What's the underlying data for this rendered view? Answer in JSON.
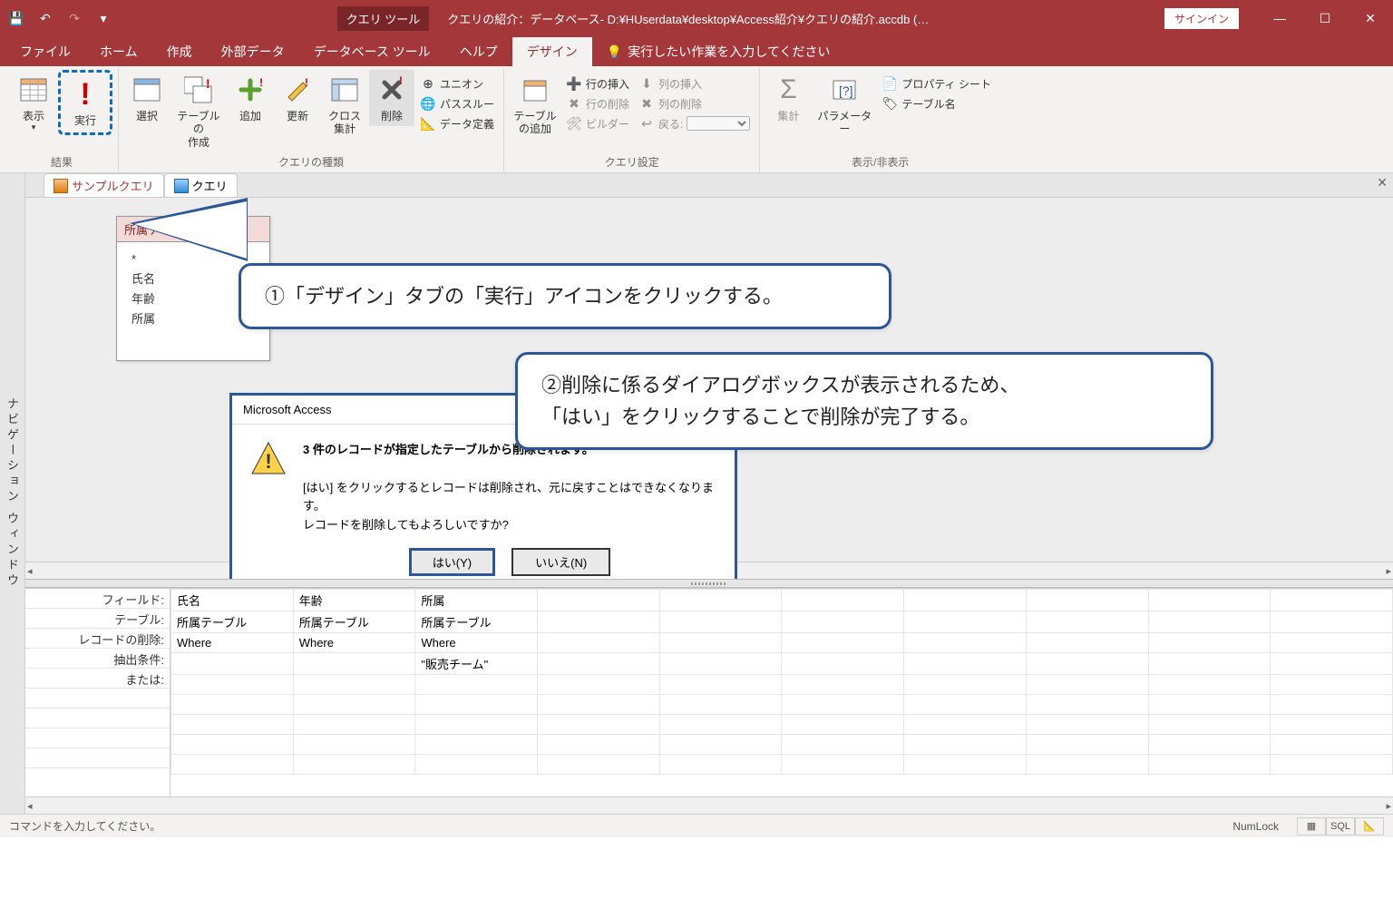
{
  "titlebar": {
    "contextual_label": "クエリ ツール",
    "title_path": "クエリの紹介：データベース- D:¥HUserdata¥desktop¥Access紹介¥クエリの紹介.accdb (…",
    "signin": "サインイン"
  },
  "tabs": {
    "file": "ファイル",
    "home": "ホーム",
    "create": "作成",
    "external": "外部データ",
    "dbtools": "データベース ツール",
    "help": "ヘルプ",
    "design": "デザイン",
    "tellme": "実行したい作業を入力してください"
  },
  "ribbon": {
    "results": {
      "view": "表示",
      "run": "実行",
      "group": "結果"
    },
    "qtype": {
      "select": "選択",
      "maketable": "テーブルの\n作成",
      "append": "追加",
      "update": "更新",
      "crosstab": "クロス\n集計",
      "delete": "削除",
      "union": "ユニオン",
      "passthrough": "パススルー",
      "datadef": "データ定義",
      "group": "クエリの種類"
    },
    "qsetup": {
      "addtable": "テーブル\nの追加",
      "insertrow": "行の挿入",
      "deleterow": "行の削除",
      "builder": "ビルダー",
      "insertcol": "列の挿入",
      "deletecol": "列の削除",
      "return": "戻る:",
      "group": "クエリ設定"
    },
    "showhide": {
      "totals": "集計",
      "params": "パラメーター",
      "propsheet": "プロパティ シート",
      "tablenames": "テーブル名",
      "group": "表示/非表示"
    }
  },
  "navpane": "ナビゲーション ウィンドウ",
  "doc_tabs": {
    "tab1": "サンプルクエリ",
    "tab2": "クエリ"
  },
  "table_card": {
    "title": "所属テーブル",
    "fields": [
      "*",
      "氏名",
      "年齢",
      "所属"
    ]
  },
  "callouts": {
    "c1": "①「デザイン」タブの「実行」アイコンをクリックする。",
    "c2a": "②削除に係るダイアログボックスが表示されるため、",
    "c2b": "「はい」をクリックすることで削除が完了する。"
  },
  "dialog": {
    "title": "Microsoft Access",
    "bold": "3 件のレコードが指定したテーブルから削除されます。",
    "line1": "[はい] をクリックするとレコードは削除され、元に戻すことはできなくなります。",
    "line2": "レコードを削除してもよろしいですか?",
    "yes": "はい(Y)",
    "no": "いいえ(N)"
  },
  "grid": {
    "labels": {
      "field": "フィールド:",
      "table": "テーブル:",
      "deleterow": "レコードの削除:",
      "criteria": "抽出条件:",
      "or": "または:"
    },
    "cols": [
      {
        "field": "氏名",
        "table": "所属テーブル",
        "del": "Where",
        "crit": "",
        "or": ""
      },
      {
        "field": "年齢",
        "table": "所属テーブル",
        "del": "Where",
        "crit": "",
        "or": ""
      },
      {
        "field": "所属",
        "table": "所属テーブル",
        "del": "Where",
        "crit": "\"販売チーム\"",
        "or": ""
      }
    ]
  },
  "status": {
    "left": "コマンドを入力してください。",
    "numlock": "NumLock",
    "sql": "SQL"
  }
}
